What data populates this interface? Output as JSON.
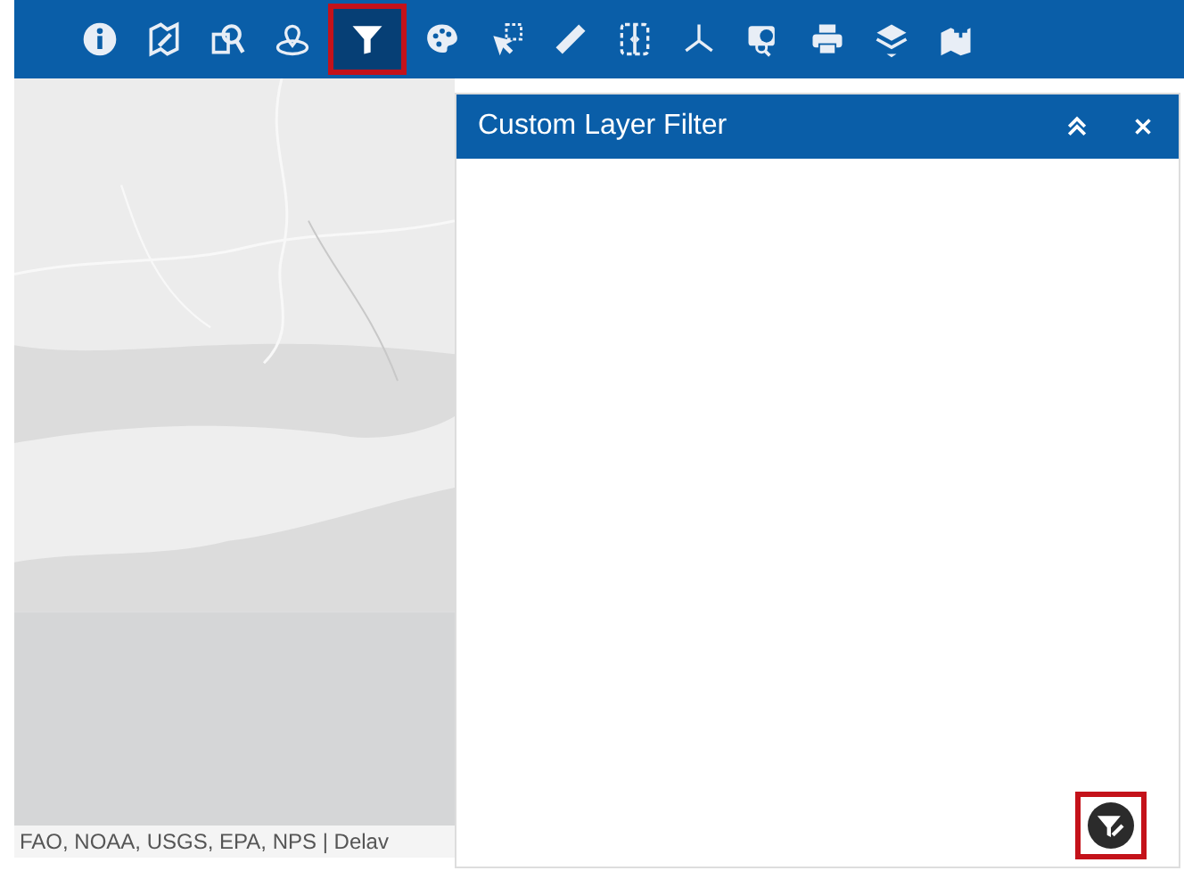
{
  "toolbar": {
    "tools": [
      {
        "kind": "info",
        "selected": false
      },
      {
        "kind": "edit-map",
        "selected": false
      },
      {
        "kind": "search-layer",
        "selected": false
      },
      {
        "kind": "location",
        "selected": false
      },
      {
        "kind": "filter",
        "selected": true
      },
      {
        "kind": "palette",
        "selected": false
      },
      {
        "kind": "select",
        "selected": false
      },
      {
        "kind": "measure",
        "selected": false
      },
      {
        "kind": "swipe",
        "selected": false
      },
      {
        "kind": "coordinates",
        "selected": false
      },
      {
        "kind": "chart",
        "selected": false
      },
      {
        "kind": "print",
        "selected": false
      },
      {
        "kind": "layers",
        "selected": false
      },
      {
        "kind": "add-data",
        "selected": false
      }
    ]
  },
  "map": {
    "attribution": "FAO, NOAA, USGS, EPA, NPS | Delav"
  },
  "panel": {
    "title": "Custom Layer Filter"
  }
}
